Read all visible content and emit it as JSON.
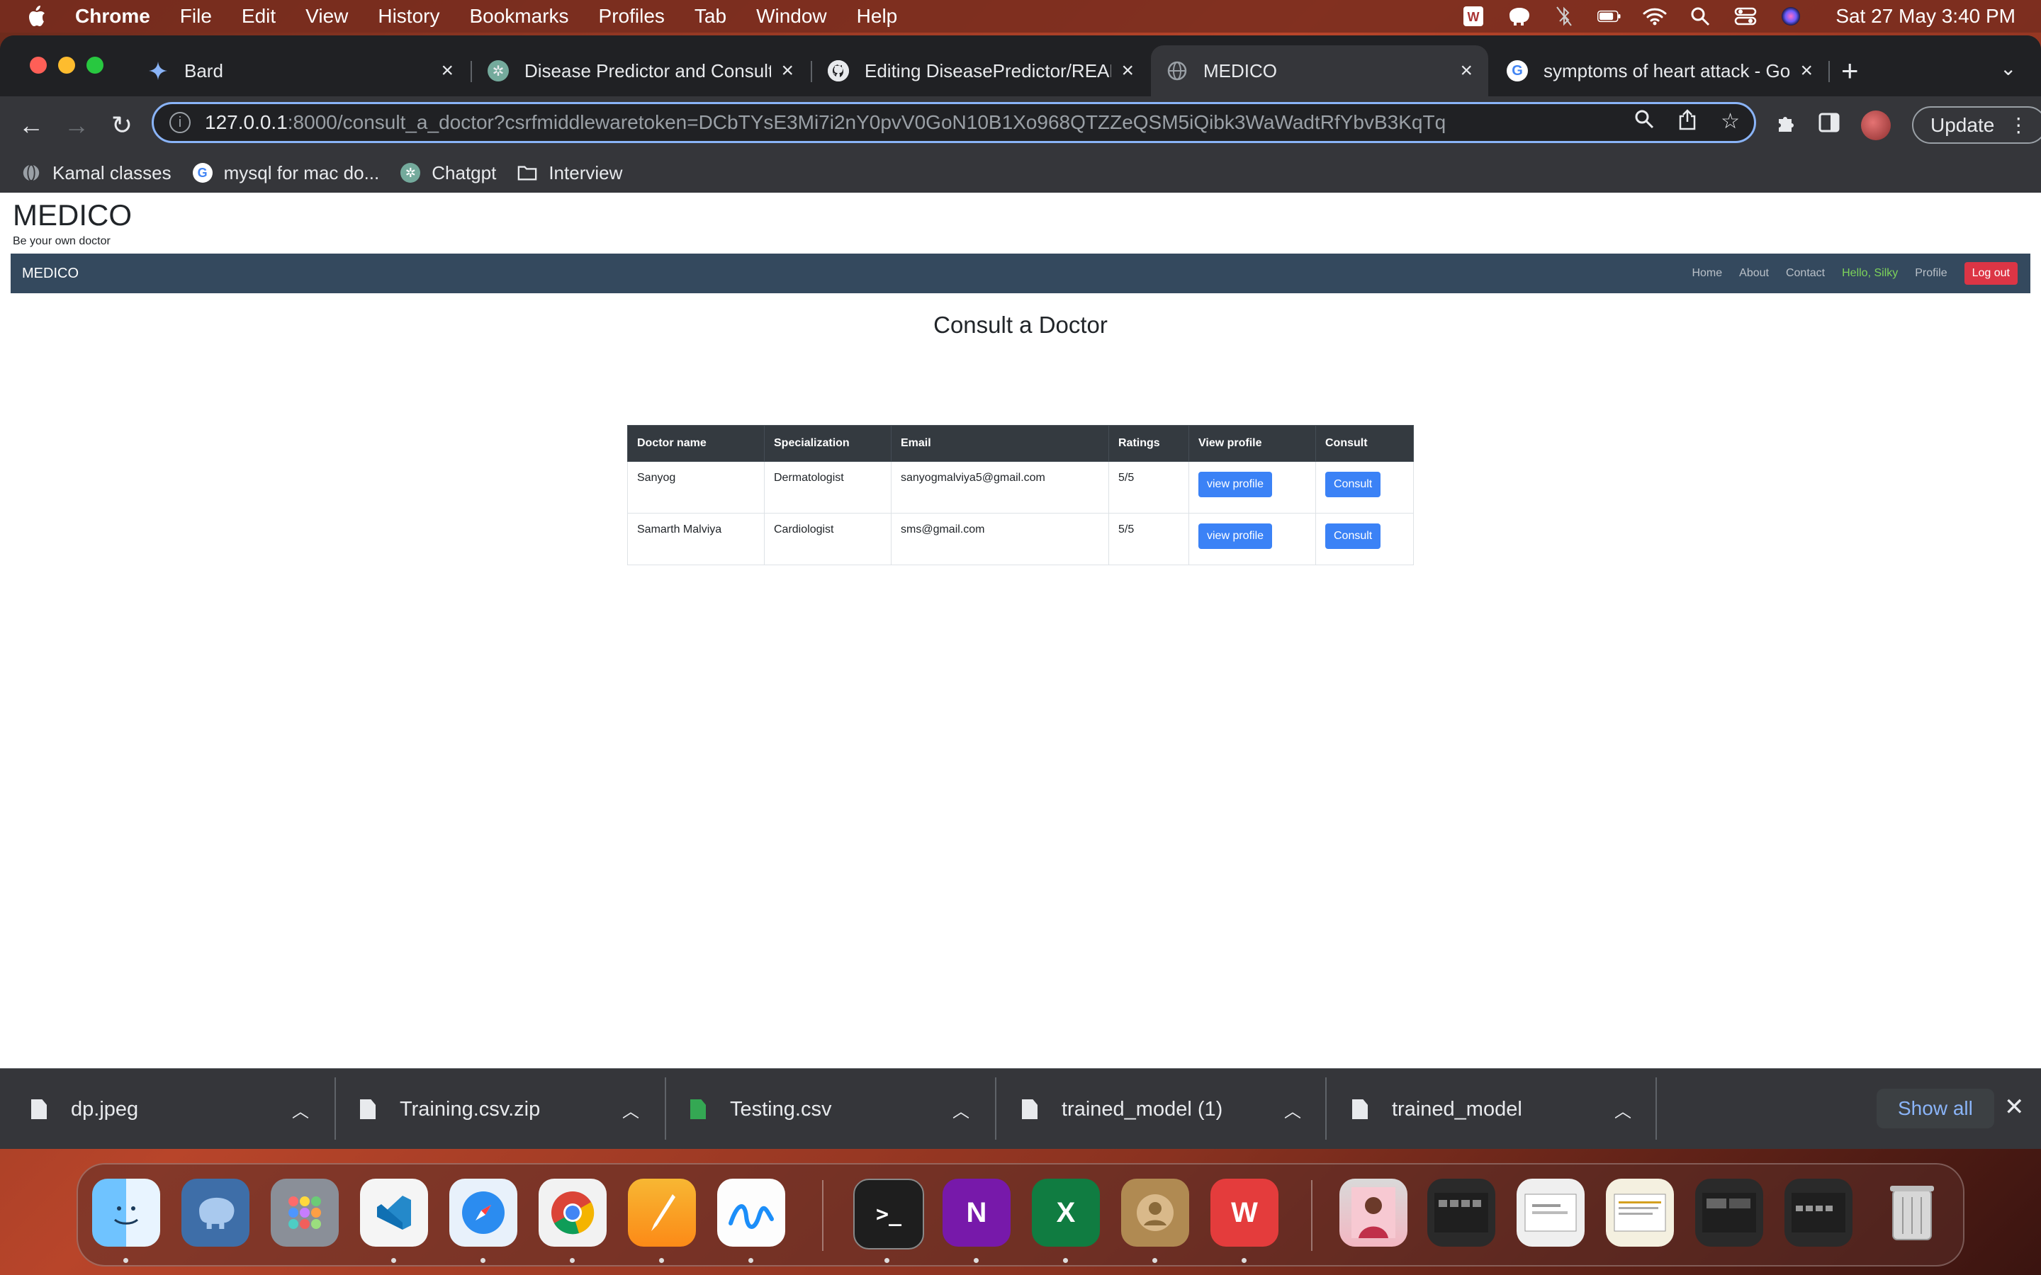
{
  "menubar": {
    "app": "Chrome",
    "items": [
      "File",
      "Edit",
      "View",
      "History",
      "Bookmarks",
      "Profiles",
      "Tab",
      "Window",
      "Help"
    ],
    "clock": "Sat 27 May  3:40 PM"
  },
  "tabs": [
    {
      "label": "Bard",
      "icon": "bard-icon"
    },
    {
      "label": "Disease Predictor and Consulta",
      "icon": "chatgpt-icon"
    },
    {
      "label": "Editing DiseasePredictor/READ",
      "icon": "github-icon"
    },
    {
      "label": "MEDICO",
      "icon": "globe-icon",
      "active": true
    },
    {
      "label": "symptoms of heart attack - Go",
      "icon": "google-icon"
    }
  ],
  "address": {
    "host": "127.0.0.1",
    "rest": ":8000/consult_a_doctor?csrfmiddlewaretoken=DCbTYsE3Mi7i2nY0pvV0GoN10B1Xo968QTZZeQSM5iQibk3WaWadtRfYbvB3KqTq"
  },
  "toolbar": {
    "update_label": "Update"
  },
  "bookmarks": [
    {
      "label": "Kamal classes",
      "icon": "globe-icon"
    },
    {
      "label": "mysql for mac do...",
      "icon": "google-icon"
    },
    {
      "label": "Chatgpt",
      "icon": "chatgpt-icon"
    },
    {
      "label": "Interview",
      "icon": "folder-icon"
    }
  ],
  "site": {
    "brand": "MEDICO",
    "tagline": "Be your own doctor",
    "navbar": {
      "brand": "MEDICO",
      "links": [
        "Home",
        "About",
        "Contact"
      ],
      "greeting": "Hello, Silky",
      "profile": "Profile",
      "logout": "Log out"
    },
    "title": "Consult a Doctor",
    "table": {
      "headers": [
        "Doctor name",
        "Specialization",
        "Email",
        "Ratings",
        "View profile",
        "Consult"
      ],
      "rows": [
        {
          "name": "Sanyog",
          "specialization": "Dermatologist",
          "email": "sanyogmalviya5@gmail.com",
          "rating": "5/5",
          "view": "view profile",
          "consult": "Consult"
        },
        {
          "name": "Samarth Malviya",
          "specialization": "Cardiologist",
          "email": "sms@gmail.com",
          "rating": "5/5",
          "view": "view profile",
          "consult": "Consult"
        }
      ]
    }
  },
  "downloads": {
    "items": [
      "dp.jpeg",
      "Training.csv.zip",
      "Testing.csv",
      "trained_model (1)",
      "trained_model"
    ],
    "show_all": "Show all"
  },
  "dock": {
    "apps": [
      "Finder",
      "TablePlus",
      "Launchpad",
      "VS Code",
      "Safari",
      "Chrome",
      "Pages",
      "Freeform",
      "Terminal",
      "OneNote",
      "Excel",
      "Contacts",
      "WPS Office"
    ]
  },
  "colors": {
    "navbar": "#34495e",
    "logout": "#dc3545",
    "primary_button": "#3b82f6",
    "greeting": "#7dd35a",
    "omnibox_focus": "#8ab4f8"
  }
}
